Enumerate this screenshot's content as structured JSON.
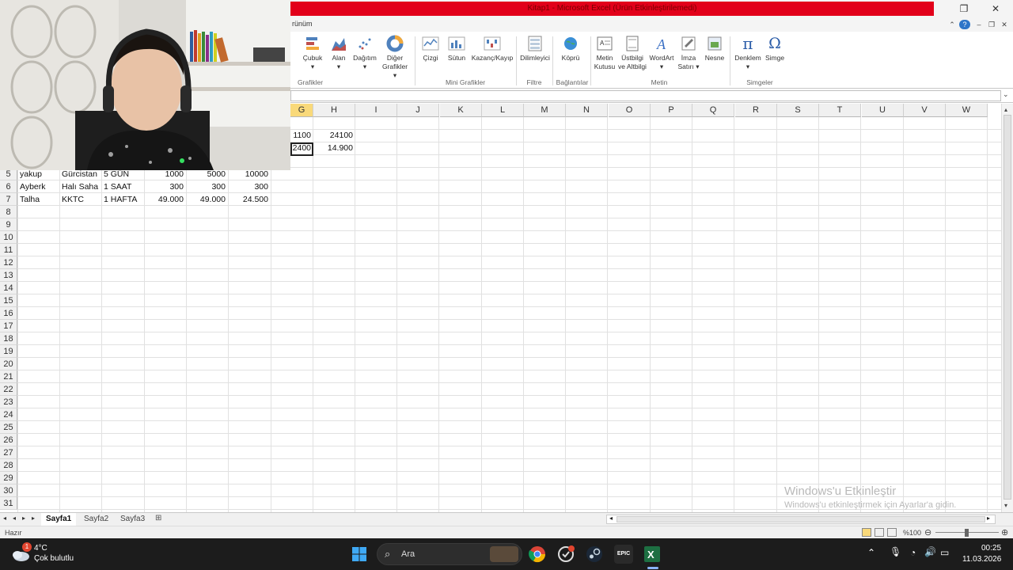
{
  "window": {
    "title": "Kitap1 - Microsoft Excel (Ürün Etkinleştirilemedi)",
    "restore_icon": "restore-icon",
    "close_icon": "close-icon"
  },
  "ribbon": {
    "tab_partial": "rünüm",
    "help_glyph": "?",
    "buttons": {
      "cubuk": "Çubuk",
      "alan": "Alan",
      "dagitim": "Dağıtım",
      "diger_grafikler_1": "Diğer",
      "diger_grafikler_2": "Grafikler",
      "cizgi": "Çizgi",
      "sutun": "Sütun",
      "kazanc_kayip": "Kazanç/Kayıp",
      "dilimleyici": "Dilimleyici",
      "kopru": "Köprü",
      "metin_kutusu_1": "Metin",
      "metin_kutusu_2": "Kutusu",
      "ustbilgi_1": "Üstbilgi",
      "ustbilgi_2": "ve Altbilgi",
      "wordart": "WordArt",
      "imza_1": "İmza",
      "imza_2": "Satırı",
      "nesne": "Nesne",
      "denklem": "Denklem",
      "simge": "Simge"
    },
    "groups": {
      "grafikler": "Grafikler",
      "mini_grafikler": "Mini Grafikler",
      "filtre": "Filtre",
      "baglantilar": "Bağlantılar",
      "metin": "Metin",
      "simgeler": "Simgeler"
    }
  },
  "grid": {
    "columns": [
      "G",
      "H",
      "I",
      "J",
      "K",
      "L",
      "M",
      "N",
      "O",
      "P",
      "Q",
      "R",
      "S",
      "T",
      "U",
      "V",
      "W"
    ],
    "rows_visible": [
      "5",
      "6",
      "7",
      "8",
      "9",
      "10",
      "11",
      "12",
      "13",
      "14",
      "15",
      "16",
      "17",
      "18",
      "19",
      "20",
      "21",
      "22",
      "23",
      "24",
      "25",
      "26",
      "27",
      "28",
      "29",
      "30",
      "31"
    ],
    "top_cells": [
      {
        "g": "1100",
        "h": "24100"
      },
      {
        "g": "2400",
        "h": "14.900"
      }
    ],
    "data_rows": [
      {
        "a": "yakup",
        "b": "Gürcistan",
        "c": "5 GÜN",
        "d": "1000",
        "e": "5000",
        "f": "10000"
      },
      {
        "a": "Ayberk",
        "b": "Halı Saha",
        "c": "1 SAAT",
        "d": "300",
        "e": "300",
        "f": "300"
      },
      {
        "a": "Talha",
        "b": "KKTC",
        "c": "1 HAFTA",
        "d": "49.000",
        "e": "49.000",
        "f": "24.500"
      }
    ]
  },
  "sheets": {
    "tabs": [
      "Sayfa1",
      "Sayfa2",
      "Sayfa3"
    ],
    "active": "Sayfa1"
  },
  "status": {
    "ready": "Hazır",
    "zoom": "%100"
  },
  "watermark": {
    "line1": "Windows'u Etkinleştir",
    "line2": "Windows'u etkinleştirmek için Ayarlar'a gidin."
  },
  "taskbar": {
    "weather_temp": "4°C",
    "weather_desc": "Çok bulutlu",
    "weather_badge": "1",
    "search_placeholder": "Ara",
    "time": "00:25",
    "date": "11.03.2026",
    "epic_label": "EPIC"
  },
  "colors": {
    "title_red": "#e2001a",
    "header_selected": "#f9d97a",
    "taskbar_bg": "#1c1c1c",
    "excel_green": "#1d6f42"
  }
}
